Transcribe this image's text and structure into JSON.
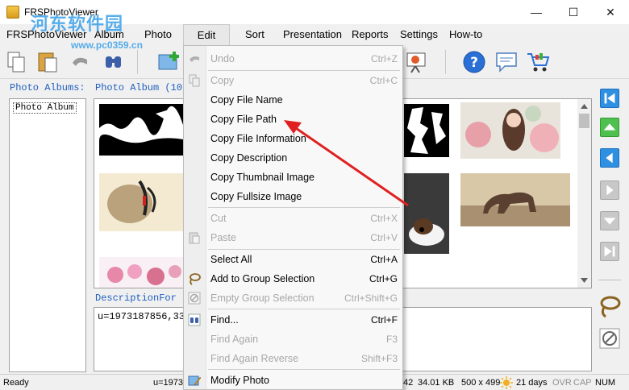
{
  "window": {
    "title": "FRSPhotoViewer",
    "controls": [
      "—",
      "☐",
      "✕"
    ]
  },
  "watermark": {
    "text": "河东软件园",
    "url": "www.pc0359.cn"
  },
  "menu": [
    "FRSPhotoViewer",
    "Album",
    "Photo",
    "Edit",
    "Sort",
    "Presentation",
    "Reports",
    "Settings",
    "How-to"
  ],
  "albums_panel": {
    "label": "Photo Albums:",
    "items": [
      "Photo Album"
    ]
  },
  "photo_panel": {
    "label": "Photo Album (10"
  },
  "description": {
    "label": "DescriptionFor",
    "text": "u=1973187856,332"
  },
  "edit_menu": {
    "items": [
      {
        "label": "Undo",
        "shortcut": "Ctrl+Z",
        "disabled": true
      },
      {
        "label": "Copy",
        "shortcut": "Ctrl+C",
        "disabled": true
      },
      {
        "label": "Copy File Name",
        "shortcut": "",
        "disabled": false
      },
      {
        "label": "Copy File Path",
        "shortcut": "",
        "disabled": false
      },
      {
        "label": "Copy File Information",
        "shortcut": "",
        "disabled": false
      },
      {
        "label": "Copy Description",
        "shortcut": "",
        "disabled": false
      },
      {
        "label": "Copy Thumbnail Image",
        "shortcut": "",
        "disabled": false
      },
      {
        "label": "Copy Fullsize Image",
        "shortcut": "",
        "disabled": false
      },
      {
        "label": "Cut",
        "shortcut": "Ctrl+X",
        "disabled": true
      },
      {
        "label": "Paste",
        "shortcut": "Ctrl+V",
        "disabled": true
      },
      {
        "label": "Select All",
        "shortcut": "Ctrl+A",
        "disabled": false
      },
      {
        "label": "Add to Group Selection",
        "shortcut": "Ctrl+G",
        "disabled": false
      },
      {
        "label": "Empty Group Selection",
        "shortcut": "Ctrl+Shift+G",
        "disabled": true
      },
      {
        "label": "Find...",
        "shortcut": "Ctrl+F",
        "disabled": false
      },
      {
        "label": "Find Again",
        "shortcut": "F3",
        "disabled": true
      },
      {
        "label": "Find Again Reverse",
        "shortcut": "Shift+F3",
        "disabled": true
      },
      {
        "label": "Modify Photo",
        "shortcut": "",
        "disabled": false
      }
    ]
  },
  "status": {
    "ready": "Ready",
    "left_value": "u=1973",
    "size_prefix": "42",
    "filesize": "34.01 KB",
    "dimensions": "500 x 499",
    "age": "21 days",
    "ovr": "OVR",
    "cap": "CAP",
    "num": "NUM"
  },
  "colors": {
    "accent": "#1f5fbf",
    "arrow": "#e02020",
    "nav_blue": "#2f8fe0",
    "nav_green": "#4fc04f"
  }
}
